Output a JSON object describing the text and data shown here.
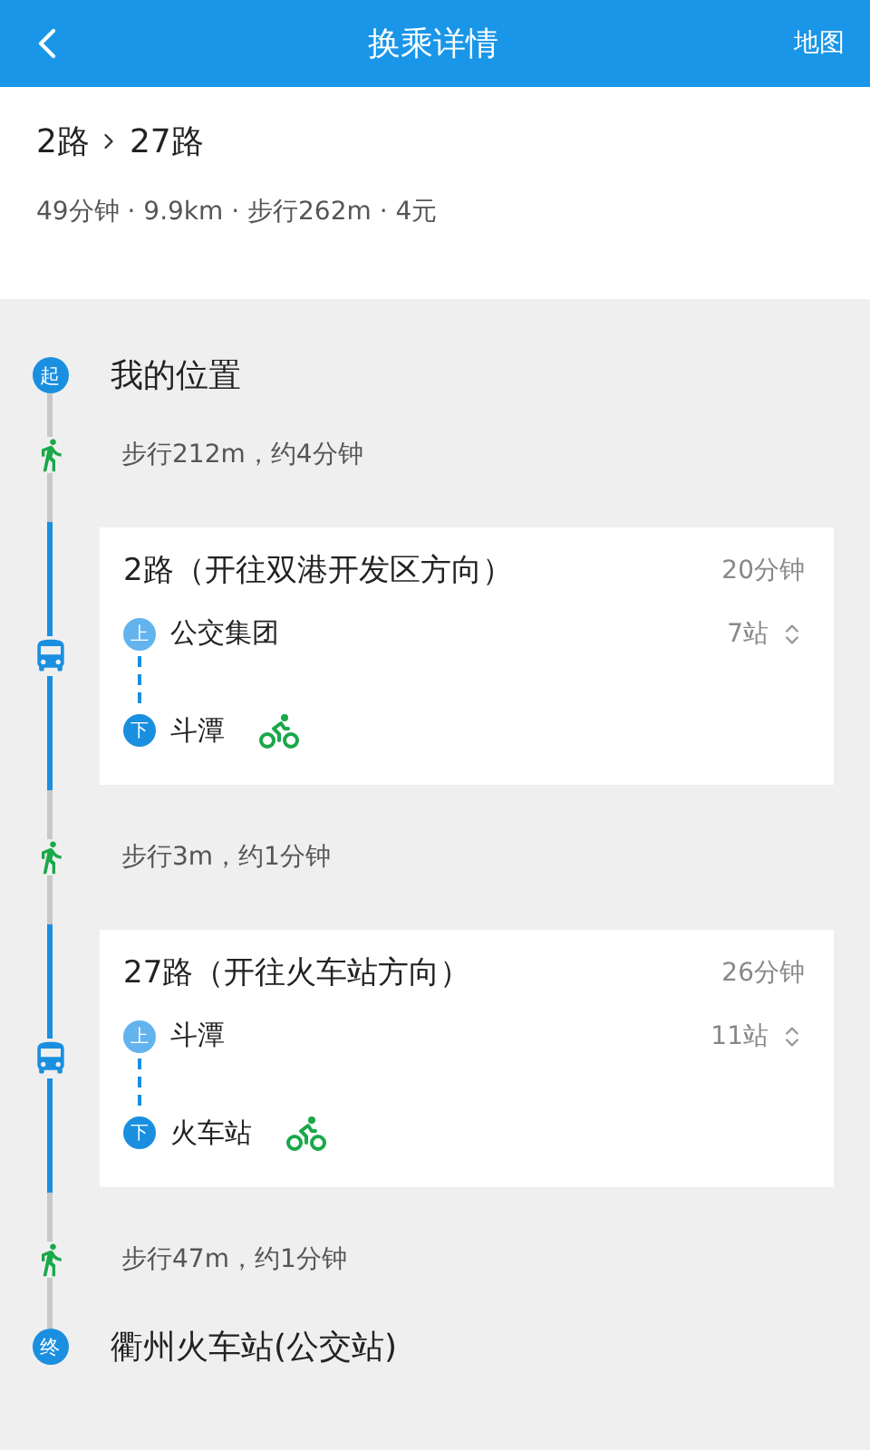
{
  "header": {
    "title": "换乘详情",
    "action": "地图"
  },
  "summary": {
    "lines": [
      "2路",
      "27路"
    ],
    "details": "49分钟 · 9.9km · 步行262m · 4元"
  },
  "steps": [
    {
      "kind": "start",
      "badge": "起",
      "place": "我的位置"
    },
    {
      "kind": "walk",
      "text": "步行212m，约4分钟"
    },
    {
      "kind": "bus",
      "line": "2路（开往双港开发区方向）",
      "duration": "20分钟",
      "board": {
        "badge": "上",
        "stop": "公交集团"
      },
      "alight": {
        "badge": "下",
        "stop": "斗潭"
      },
      "stops": "7站"
    },
    {
      "kind": "walk",
      "text": "步行3m，约1分钟"
    },
    {
      "kind": "bus",
      "line": "27路（开往火车站方向）",
      "duration": "26分钟",
      "board": {
        "badge": "上",
        "stop": "斗潭"
      },
      "alight": {
        "badge": "下",
        "stop": "火车站"
      },
      "stops": "11站"
    },
    {
      "kind": "walk",
      "text": "步行47m，约1分钟"
    },
    {
      "kind": "end",
      "badge": "终",
      "place": "衢州火车站(公交站)"
    }
  ]
}
